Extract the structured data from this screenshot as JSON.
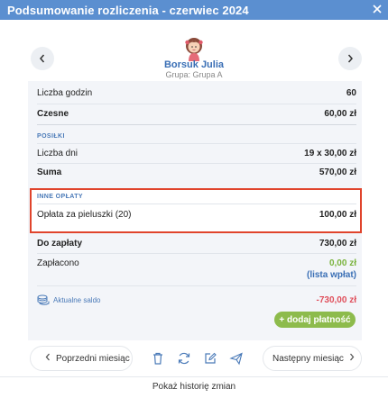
{
  "window": {
    "title": "Podsumowanie rozliczenia - czerwiec 2024"
  },
  "child": {
    "name": "Borsuk Julia",
    "group": "Grupa: Grupa A"
  },
  "summary": {
    "hours": {
      "label": "Liczba godzin",
      "value": "60"
    },
    "tuition": {
      "label": "Czesne",
      "value": "60,00 zł"
    },
    "meals": {
      "section": "POSIŁKI",
      "days": {
        "label": "Liczba dni",
        "value": "19 x 30,00 zł"
      },
      "sum": {
        "label": "Suma",
        "value": "570,00 zł"
      }
    },
    "other": {
      "section": "INNE OPŁATY",
      "diapers": {
        "label": "Opłata za pieluszki (20)",
        "value": "100,00 zł"
      }
    },
    "to_pay": {
      "label": "Do zapłaty",
      "value": "730,00 zł"
    },
    "paid": {
      "label": "Zapłacono",
      "value": "0,00 zł",
      "link": "(lista wpłat)"
    },
    "balance": {
      "label": "Aktualne saldo",
      "value": "-730,00 zł"
    },
    "add_payment": "+ dodaj płatność"
  },
  "footer": {
    "prev": "Poprzedni miesiąc",
    "next": "Następny miesiąc",
    "history": "Pokaż historię zmian"
  },
  "colors": {
    "titlebar": "#5b8fd0",
    "accent": "#3a6fb5",
    "highlight": "#e0442c",
    "negative": "#e0505c",
    "positive": "#7ab33d",
    "add_button": "#8dbb4c"
  },
  "icons": {
    "close": "close-icon",
    "nav_prev": "chevron-left-icon",
    "nav_next": "chevron-right-icon",
    "tools": [
      "trash-icon",
      "refresh-icon",
      "edit-icon",
      "send-icon"
    ],
    "balance": "coins-icon"
  }
}
